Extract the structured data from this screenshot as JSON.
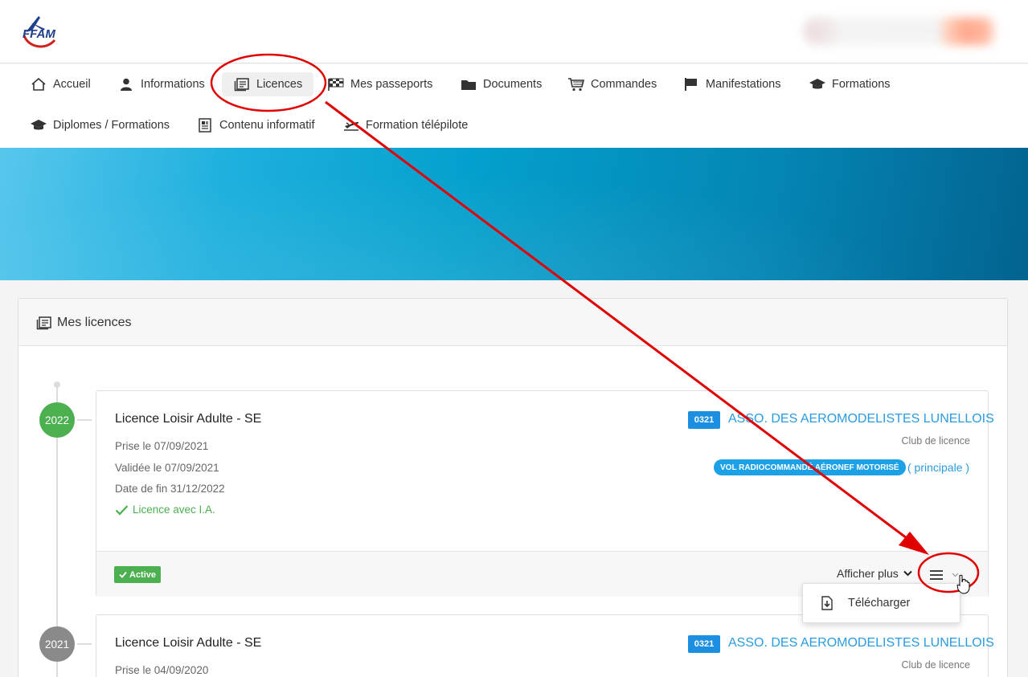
{
  "logo": {
    "text": "FFAM"
  },
  "nav": [
    {
      "label": "Accueil",
      "icon": "home-icon"
    },
    {
      "label": "Informations",
      "icon": "user-icon"
    },
    {
      "label": "Licences",
      "icon": "licence-icon",
      "active": true
    },
    {
      "label": "Mes passeports",
      "icon": "checkered-flag-icon"
    },
    {
      "label": "Documents",
      "icon": "folder-icon"
    },
    {
      "label": "Commandes",
      "icon": "cart-icon"
    },
    {
      "label": "Manifestations",
      "icon": "flag-icon"
    },
    {
      "label": "Formations",
      "icon": "graduation-cap-icon"
    },
    {
      "label": "Diplomes / Formations",
      "icon": "graduation-cap-icon"
    },
    {
      "label": "Contenu informatif",
      "icon": "document-icon"
    },
    {
      "label": "Formation télépilote",
      "icon": "plane-icon"
    }
  ],
  "panel": {
    "title": "Mes licences"
  },
  "licences": [
    {
      "year": "2022",
      "title": "Licence Loisir Adulte - SE",
      "taken": "Prise le 07/09/2021",
      "validated": "Validée le 07/09/2021",
      "end": "Date de fin 31/12/2022",
      "ia": "Licence avec I.A.",
      "club_code": "0321",
      "club_name": "ASSO. DES AEROMODELISTES LUNELLOIS",
      "club_label": "Club de licence",
      "discipline": "VOL RADIOCOMMANDÉ AÉRONEF MOTORISÉ",
      "principal": "( principale )",
      "status": "Active",
      "more": "Afficher plus"
    },
    {
      "year": "2021",
      "title": "Licence Loisir Adulte - SE",
      "taken": "Prise le 04/09/2020",
      "club_code": "0321",
      "club_name": "ASSO. DES AEROMODELISTES LUNELLOIS",
      "club_label": "Club de licence"
    }
  ],
  "dropdown": {
    "download": "Télécharger"
  },
  "colors": {
    "accent": "#2a9be0",
    "active_green": "#4caf50",
    "annotation_red": "#e00000"
  }
}
